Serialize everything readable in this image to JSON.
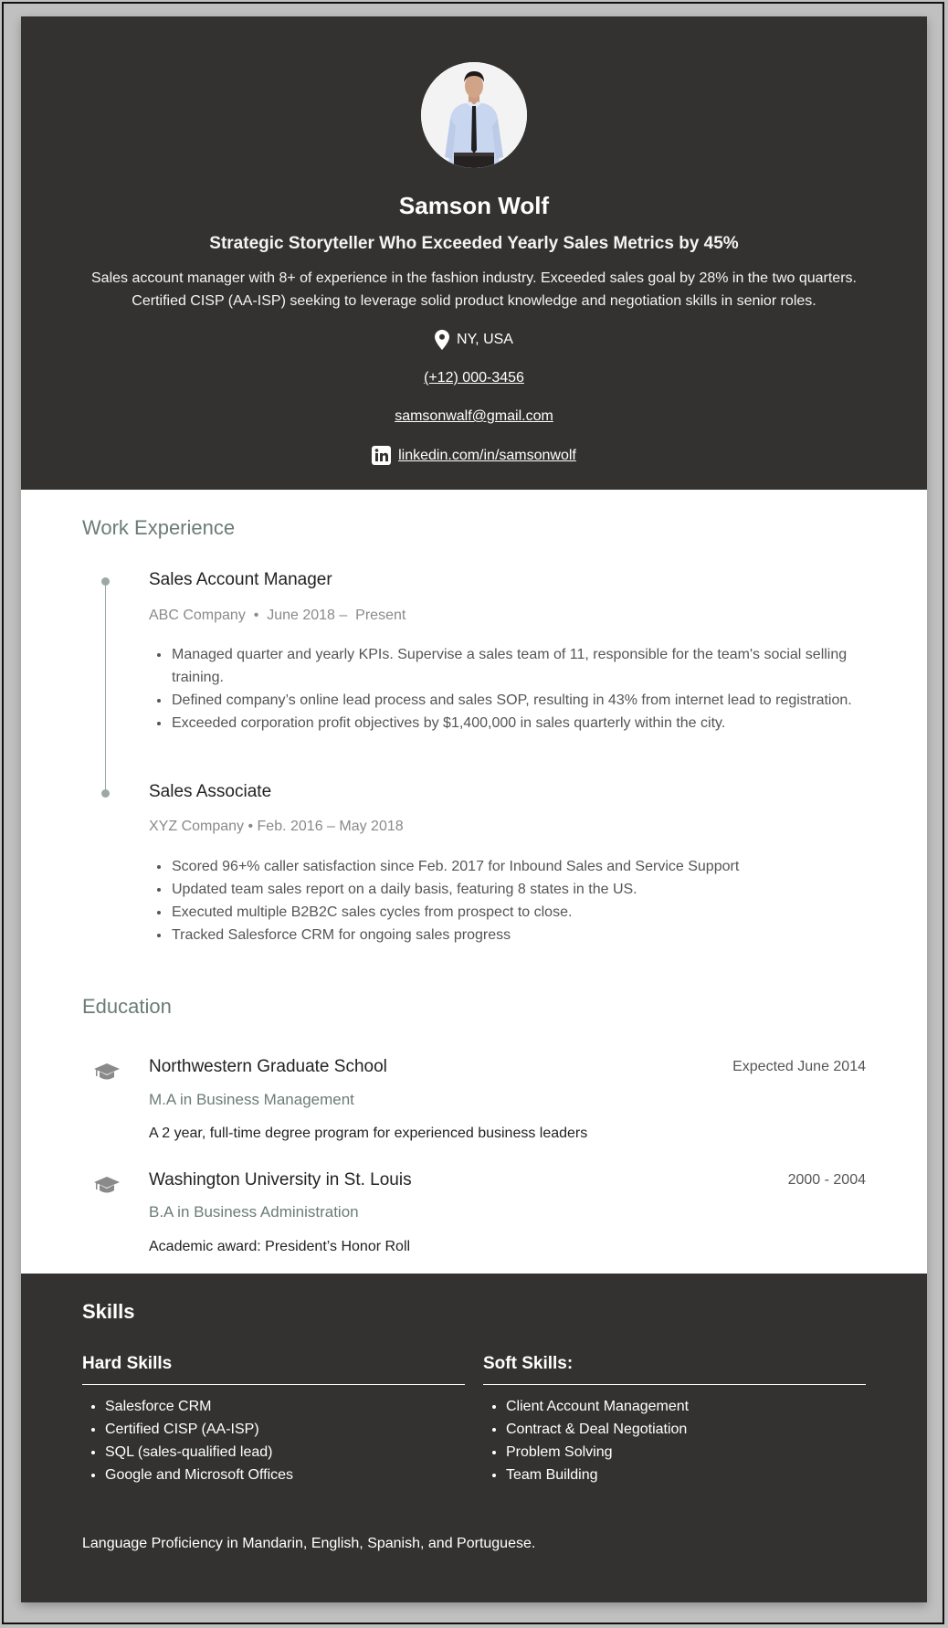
{
  "colors": {
    "dark_bg": "#333231",
    "accent": "#6b7d74",
    "timeline": "#9aaaa2",
    "frame_bg": "#c0c0c0"
  },
  "header": {
    "photo_alt": "Profile photo of Samson Wolf",
    "name": "Samson Wolf",
    "headline": "Strategic Storyteller Who Exceeded Yearly Sales Metrics by 45%",
    "summary": "Sales account manager with 8+ of experience in the fashion industry. Exceeded sales goal by 28% in the two quarters. Certified CISP (AA-ISP) seeking to leverage solid product knowledge and negotiation skills in senior roles.",
    "location": "NY, USA",
    "location_icon": "map-pin-icon",
    "phone": "(+12) 000-3456",
    "email": "samsonwalf@gmail.com",
    "linkedin": "linkedin.com/in/samsonwolf",
    "linkedin_icon": "linkedin-icon"
  },
  "work": {
    "title": "Work Experience",
    "jobs": [
      {
        "title": "Sales Account Manager",
        "meta": "ABC Company  •  June 2018 –  Present",
        "bullets": [
          "Managed quarter and yearly KPIs. Supervise a sales team of 11, responsible for the team's social selling training.",
          "Defined company’s online lead process and sales SOP, resulting in 43% from internet lead to registration.",
          "Exceeded corporation profit objectives by $1,400,000 in sales quarterly within the city."
        ]
      },
      {
        "title": "Sales Associate",
        "meta": "XYZ Company • Feb. 2016 – May 2018",
        "bullets": [
          "Scored 96+% caller satisfaction since Feb. 2017 for Inbound Sales and Service Support",
          "Updated team sales report on a daily basis, featuring 8 states in the US.",
          "Executed multiple B2B2C sales cycles from prospect to close.",
          "Tracked Salesforce CRM for ongoing sales progress"
        ]
      }
    ]
  },
  "education": {
    "title": "Education",
    "icon": "graduation-cap-icon",
    "items": [
      {
        "school": "Northwestern Graduate School",
        "degree": "M.A in Business Management",
        "description": "A 2 year, full-time degree program for experienced business leaders",
        "date": "Expected June 2014"
      },
      {
        "school": "Washington University in St. Louis",
        "degree": "B.A in Business Administration",
        "description": "Academic award: President’s Honor Roll",
        "date": "2000 - 2004"
      }
    ]
  },
  "skills": {
    "title": "Skills",
    "hard": {
      "title": "Hard Skills",
      "items": [
        "Salesforce CRM",
        "Certified CISP (AA-ISP)",
        "SQL (sales-qualified lead)",
        "Google and Microsoft Offices"
      ]
    },
    "soft": {
      "title": "Soft Skills:",
      "items": [
        "Client Account Management",
        "Contract & Deal Negotiation",
        "Problem Solving",
        "Team Building"
      ]
    },
    "languages": "Language Proficiency in Mandarin, English, Spanish, and Portuguese."
  }
}
